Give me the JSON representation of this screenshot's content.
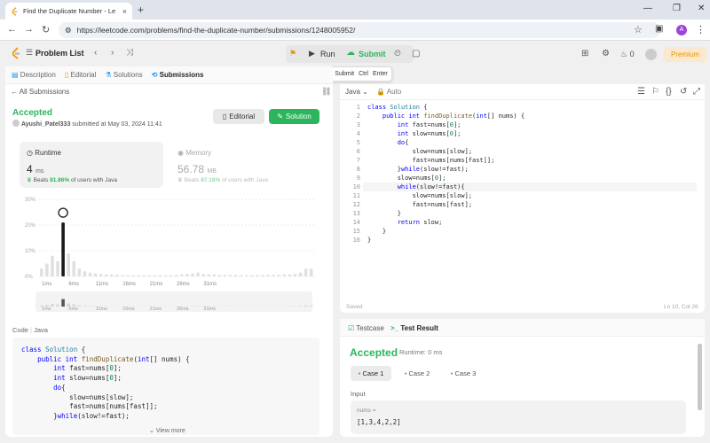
{
  "browser": {
    "tab_title": "Find the Duplicate Number - Le",
    "url": "https://leetcode.com/problems/find-the-duplicate-number/submissions/1248005952/",
    "profile_initial": "A"
  },
  "nav": {
    "problem_list": "Problem List",
    "run": "Run",
    "submit": "Submit",
    "tooltip": [
      "Submit",
      "Ctrl",
      "Enter"
    ],
    "streak": "0",
    "premium": "Premium"
  },
  "left_tabs": [
    "Description",
    "Editorial",
    "Solutions",
    "Submissions"
  ],
  "submission": {
    "back": "All Submissions",
    "status": "Accepted",
    "author": "Ayushi_Patel333",
    "submitted": "submitted at May 03, 2024 11:41",
    "editorial_btn": "Editorial",
    "solution_btn": "Solution",
    "runtime_label": "Runtime",
    "runtime_value": "4",
    "runtime_unit": "ms",
    "runtime_beats_pre": "Beats",
    "runtime_beats": "81.86%",
    "runtime_beats_post": "of users with Java",
    "memory_label": "Memory",
    "memory_value": "56.78",
    "memory_unit": "MB",
    "memory_beats_pre": "Beats",
    "memory_beats": "87.18%",
    "memory_beats_post": "of users with Java"
  },
  "chart_data": {
    "type": "bar",
    "ylabels": [
      "30%",
      "20%",
      "10%",
      "0%"
    ],
    "xlabels": [
      "1ms",
      "6ms",
      "11ms",
      "16ms",
      "21ms",
      "26ms",
      "31ms"
    ],
    "values": [
      3,
      5,
      8,
      6,
      21,
      9,
      6,
      3,
      2,
      1.5,
      1.2,
      1,
      0.8,
      0.8,
      0.6,
      0.6,
      0.5,
      0.5,
      0.5,
      0.5,
      0.5,
      0.5,
      0.5,
      0.5,
      0.5,
      0.6,
      0.8,
      1,
      1.2,
      1.5,
      1,
      0.8,
      0.8,
      0.6,
      0.6,
      0.6,
      0.6,
      0.5,
      0.5,
      0.5,
      0.5,
      0.6,
      0.6,
      0.6,
      0.6,
      0.8,
      0.8,
      1,
      1.5,
      3,
      3
    ],
    "highlight_index": 4,
    "ylim": [
      0,
      30
    ]
  },
  "code_preview": {
    "label": "Code",
    "lang": "Java",
    "lines": [
      "class Solution {",
      "    public int findDuplicate(int[] nums) {",
      "        int fast=nums[0];",
      "        int slow=nums[0];",
      "        do{",
      "            slow=nums[slow];",
      "            fast=nums[nums[fast]];",
      "        }while(slow!=fast);"
    ],
    "view_more": "View more"
  },
  "editor": {
    "lang": "Java",
    "mode": "Auto",
    "lines": [
      "class Solution {",
      "    public int findDuplicate(int[] nums) {",
      "        int fast=nums[0];",
      "        int slow=nums[0];",
      "        do{",
      "            slow=nums[slow];",
      "            fast=nums[nums[fast]];",
      "        }while(slow!=fast);",
      "        slow=nums[0];",
      "        while(slow!=fast){",
      "            slow=nums[slow];",
      "            fast=nums[fast];",
      "        }",
      "        return slow;",
      "    }",
      "}"
    ],
    "saved": "Saved",
    "position": "Ln 10, Col 26"
  },
  "result": {
    "testcase_tab": "Testcase",
    "result_tab": "Test Result",
    "status": "Accepted",
    "runtime": "Runtime: 0 ms",
    "cases": [
      "Case 1",
      "Case 2",
      "Case 3"
    ],
    "input_label": "Input",
    "var_name": "nums =",
    "var_value": "[1,3,4,2,2]"
  }
}
